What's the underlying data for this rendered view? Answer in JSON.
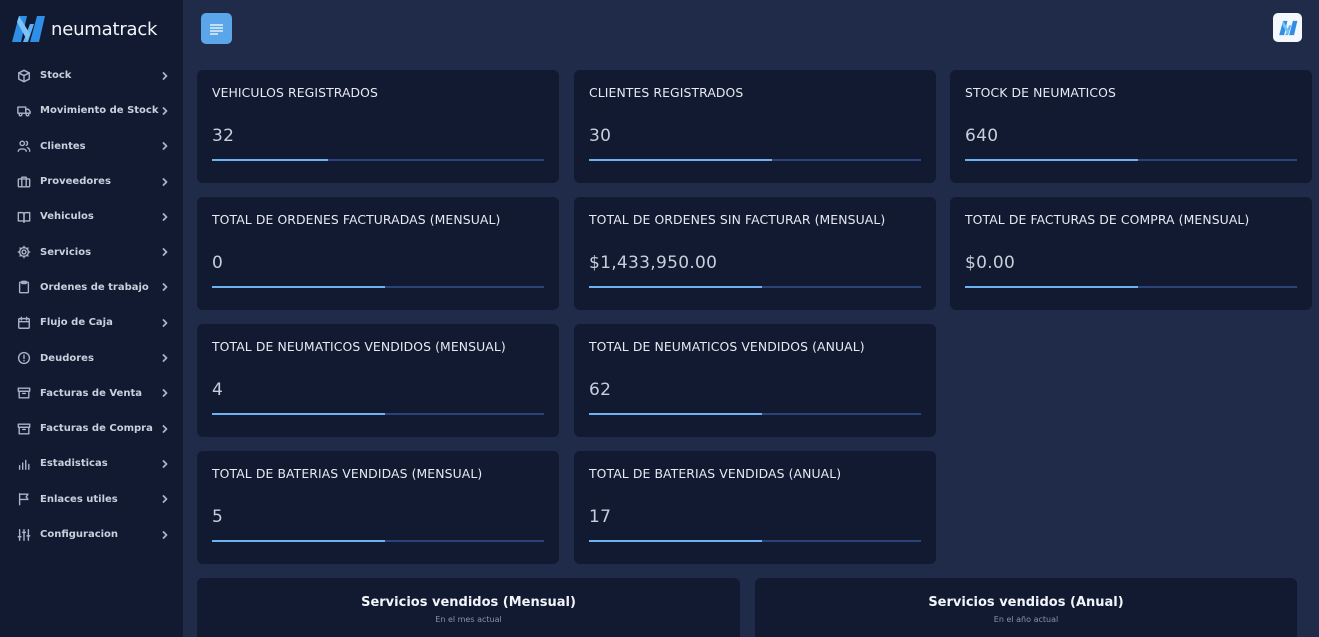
{
  "brand": {
    "name": "neumatrack",
    "logo": "neumatrack-logo"
  },
  "sidebar": {
    "items": [
      {
        "label": "Stock",
        "icon": "box-icon"
      },
      {
        "label": "Movimiento de Stock",
        "icon": "truck-icon"
      },
      {
        "label": "Clientes",
        "icon": "users-icon"
      },
      {
        "label": "Proveedores",
        "icon": "briefcase-icon"
      },
      {
        "label": "Vehiculos",
        "icon": "book-icon"
      },
      {
        "label": "Servicios",
        "icon": "gear-icon"
      },
      {
        "label": "Ordenes de trabajo",
        "icon": "clipboard-icon"
      },
      {
        "label": "Flujo de Caja",
        "icon": "calendar-icon"
      },
      {
        "label": "Deudores",
        "icon": "alert-circle-icon"
      },
      {
        "label": "Facturas de Venta",
        "icon": "archive-icon"
      },
      {
        "label": "Facturas de Compra",
        "icon": "archive-icon"
      },
      {
        "label": "Estadisticas",
        "icon": "bar-chart-icon"
      },
      {
        "label": "Enlaces utiles",
        "icon": "flag-icon"
      },
      {
        "label": "Configuracion",
        "icon": "sliders-icon"
      }
    ]
  },
  "topbar": {
    "menu_icon": "menu-icon",
    "avatar_icon": "neumatrack-logo"
  },
  "cards": [
    {
      "title": "VEHICULOS REGISTRADOS",
      "value": "32",
      "progress": 0.35
    },
    {
      "title": "CLIENTES REGISTRADOS",
      "value": "30",
      "progress": 0.55
    },
    {
      "title": "STOCK DE NEUMATICOS",
      "value": "640",
      "progress": 0.52
    },
    {
      "title": "TOTAL DE ORDENES FACTURADAS (MENSUAL)",
      "value": "0",
      "progress": 0.52
    },
    {
      "title": "TOTAL DE ORDENES SIN FACTURAR (MENSUAL)",
      "value": "$1,433,950.00",
      "progress": 0.52
    },
    {
      "title": "TOTAL DE FACTURAS DE COMPRA (MENSUAL)",
      "value": "$0.00",
      "progress": 0.52
    },
    {
      "title": "TOTAL DE NEUMATICOS VENDIDOS (MENSUAL)",
      "value": "4",
      "progress": 0.52
    },
    {
      "title": "TOTAL DE NEUMATICOS VENDIDOS (ANUAL)",
      "value": "62",
      "progress": 0.52
    },
    {
      "title": "TOTAL DE BATERIAS VENDIDAS (MENSUAL)",
      "value": "5",
      "progress": 0.52
    },
    {
      "title": "TOTAL DE BATERIAS VENDIDAS (ANUAL)",
      "value": "17",
      "progress": 0.52
    }
  ],
  "bottom_panels": [
    {
      "title": "Servicios vendidos (Mensual)",
      "subtitle": "En el mes actual"
    },
    {
      "title": "Servicios vendidos (Anual)",
      "subtitle": "En el año actual"
    }
  ],
  "colors": {
    "background": "#1f2b49",
    "panel": "#111a30",
    "accent": "#5aa6e8",
    "bar_fill": "#6db3f2",
    "bar_track": "#2b4378"
  }
}
